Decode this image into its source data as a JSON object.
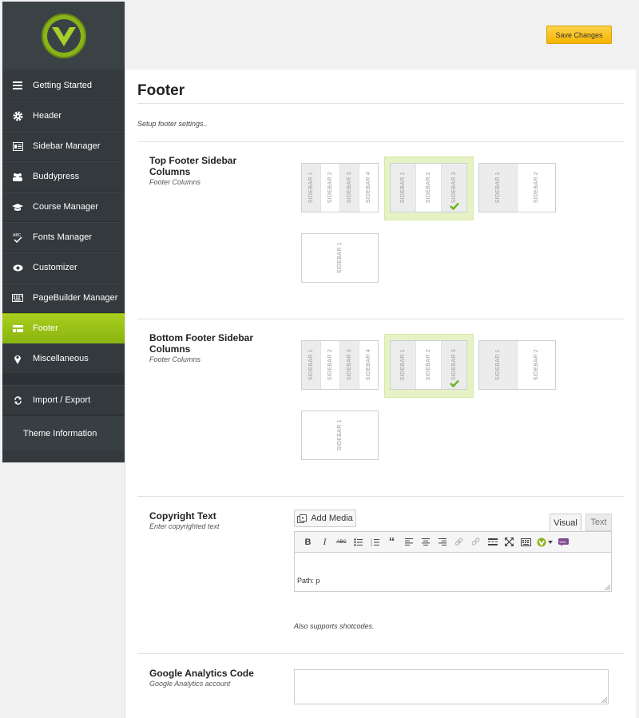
{
  "sidebar": {
    "items": [
      {
        "label": "Getting Started",
        "icon": "menu-icon"
      },
      {
        "label": "Header",
        "icon": "gear-icon"
      },
      {
        "label": "Sidebar Manager",
        "icon": "sidebar-icon"
      },
      {
        "label": "Buddypress",
        "icon": "users-icon"
      },
      {
        "label": "Course Manager",
        "icon": "graduation-cap-icon"
      },
      {
        "label": "Fonts Manager",
        "icon": "abc-check-icon"
      },
      {
        "label": "Customizer",
        "icon": "eye-icon"
      },
      {
        "label": "PageBuilder Manager",
        "icon": "keyboard-icon"
      },
      {
        "label": "Footer",
        "icon": "footer-icon",
        "active": true
      },
      {
        "label": "Miscellaneous",
        "icon": "map-pin-icon"
      }
    ],
    "import_export": "Import / Export",
    "theme_info": "Theme Information"
  },
  "toolbar": {
    "save_label": "Save Changes"
  },
  "page": {
    "title": "Footer",
    "description": "Setup footer settings.."
  },
  "top_footer": {
    "title": "Top Footer Sidebar Columns",
    "subtitle": "Footer Columns",
    "selected_option": 2
  },
  "bottom_footer": {
    "title": "Bottom Footer Sidebar Columns",
    "subtitle": "Footer Columns",
    "selected_option": 2
  },
  "layout_labels": {
    "s1": "SIDEBAR 1",
    "s2": "SIDEBAR 2",
    "s3": "SIDEBAR 3",
    "s4": "SIDEBAR 4"
  },
  "copyright": {
    "title": "Copyright Text",
    "subtitle": "Enter copyrighted text",
    "add_media": "Add Media",
    "tab_visual": "Visual",
    "tab_text": "Text",
    "path": "Path: p",
    "note": "Also supports shotcodes."
  },
  "analytics": {
    "title": "Google Analytics Code",
    "subtitle": "Google Analytics account",
    "value": ""
  },
  "colors": {
    "accent": "#9bc31a",
    "save": "#f9c52a",
    "sidebar_bg": "#33393d"
  }
}
